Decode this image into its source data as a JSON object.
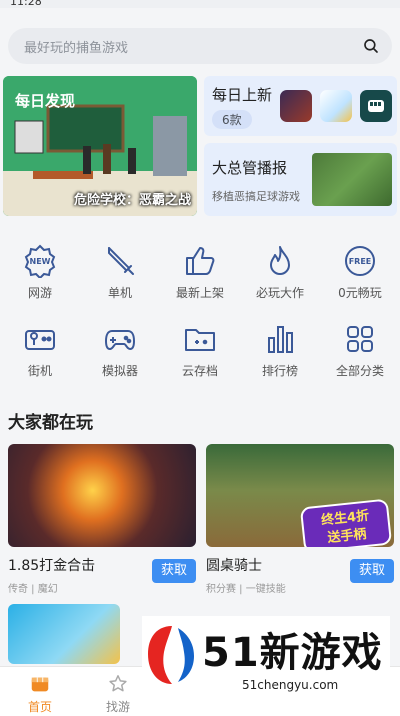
{
  "status": {
    "time": "11:28"
  },
  "search": {
    "placeholder": "最好玩的捕鱼游戏"
  },
  "banner": {
    "title": "每日发现",
    "caption": "危险学校：恶霸之战"
  },
  "daily": {
    "title": "每日上新",
    "count": "6款"
  },
  "news": {
    "title": "大总管播报",
    "subtitle": "移植恶搞足球游戏"
  },
  "categories": [
    {
      "label": "网游",
      "icon": "new-badge-icon"
    },
    {
      "label": "单机",
      "icon": "sword-icon"
    },
    {
      "label": "最新上架",
      "icon": "thumbs-up-icon"
    },
    {
      "label": "必玩大作",
      "icon": "flame-icon"
    },
    {
      "label": "0元畅玩",
      "icon": "free-badge-icon"
    },
    {
      "label": "街机",
      "icon": "arcade-icon"
    },
    {
      "label": "模拟器",
      "icon": "gamepad-icon"
    },
    {
      "label": "云存档",
      "icon": "cloud-folder-icon"
    },
    {
      "label": "排行榜",
      "icon": "bar-chart-icon"
    },
    {
      "label": "全部分类",
      "icon": "grid-icon"
    }
  ],
  "section": {
    "title": "大家都在玩"
  },
  "games": [
    {
      "name": "1.85打金合击",
      "tags": "传奇 | 魔幻",
      "action": "获取"
    },
    {
      "name": "圆桌骑士",
      "tags": "积分赛 | 一键技能",
      "action": "获取",
      "promo_line1": "终生4折",
      "promo_line2": "送手柄"
    }
  ],
  "nav": [
    {
      "label": "首页",
      "icon": "home-icon",
      "active": true
    },
    {
      "label": "找游",
      "icon": "star-icon",
      "active": false
    }
  ],
  "watermark": {
    "text": "51新游戏",
    "url": "51chengyu.com"
  },
  "colors": {
    "accent": "#3d8ef2",
    "nav_active": "#f08a24",
    "icon": "#3b5998"
  }
}
